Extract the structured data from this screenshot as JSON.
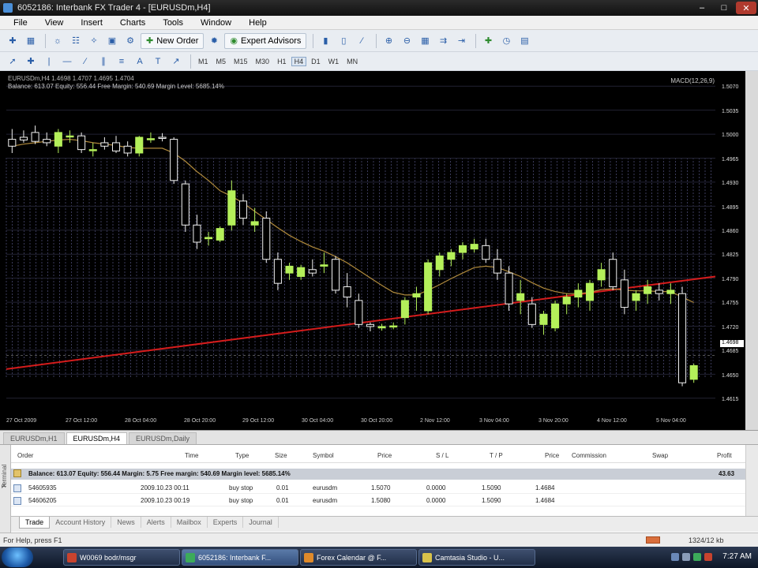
{
  "window": {
    "title": "6052186: Interbank FX Trader 4 - [EURUSDm,H4]"
  },
  "menu": [
    "File",
    "View",
    "Insert",
    "Charts",
    "Tools",
    "Window",
    "Help"
  ],
  "toolbar": {
    "new_order_label": "New Order",
    "expert_advisors_label": "Expert Advisors",
    "timeframes": [
      "M1",
      "M5",
      "M15",
      "M30",
      "H1",
      "H4",
      "D1",
      "W1",
      "MN"
    ],
    "active_timeframe": "H4"
  },
  "chart": {
    "symbol_line": "EURUSDm,H4 1.4698 1.4707 1.4695 1.4704",
    "info_line": "Balance: 613.07  Equity: 556.44  Free Margin: 540.69  Margin Level: 5685.14%",
    "indicator_label": "MACD(12,26,9)",
    "price_labels": [
      "1.5070",
      "1.5035",
      "1.5000",
      "1.4965",
      "1.4930",
      "1.4895",
      "1.4860",
      "1.4825",
      "1.4790",
      "1.4755",
      "1.4720",
      "1.4685",
      "1.4650",
      "1.4615"
    ],
    "current_price_tag": "1.4698",
    "time_labels": [
      "27 Oct 2009",
      "27 Oct 12:00",
      "28 Oct 04:00",
      "28 Oct 20:00",
      "29 Oct 12:00",
      "30 Oct 04:00",
      "30 Oct 20:00",
      "2 Nov 12:00",
      "3 Nov 04:00",
      "3 Nov 20:00",
      "4 Nov 12:00",
      "5 Nov 04:00"
    ]
  },
  "chart_tabs": [
    "EURUSDm,H1",
    "EURUSDm,H4",
    "EURUSDm,Daily"
  ],
  "active_chart_tab": "EURUSDm,H4",
  "terminal": {
    "side_label": "Terminal",
    "columns": [
      "Order",
      "Time",
      "Type",
      "Size",
      "Symbol",
      "Price",
      "S / L",
      "T / P",
      "Price",
      "Commission",
      "Swap",
      "Profit"
    ],
    "balance_row": "Balance: 613.07  Equity: 556.44  Margin: 5.75  Free margin: 540.69  Margin level: 5685.14%",
    "balance_profit": "43.63",
    "orders": [
      {
        "order": "54605935",
        "time": "2009.10.23 00:11",
        "type": "buy stop",
        "size": "0.01",
        "symbol": "eurusdm",
        "price": "1.5070",
        "sl": "0.0000",
        "tp": "1.5090",
        "current": "1.4684"
      },
      {
        "order": "54606205",
        "time": "2009.10.23 00:19",
        "type": "buy stop",
        "size": "0.01",
        "symbol": "eurusdm",
        "price": "1.5080",
        "sl": "0.0000",
        "tp": "1.5090",
        "current": "1.4684"
      }
    ],
    "tabs": [
      "Trade",
      "Account History",
      "News",
      "Alerts",
      "Mailbox",
      "Experts",
      "Journal"
    ],
    "active_tab": "Trade"
  },
  "status": {
    "help": "For Help, press F1",
    "traffic": "1324/12 kb"
  },
  "taskbar": {
    "items": [
      "W0069 bodr/msgr",
      "6052186: Interbank F...",
      "Forex Calendar @ F...",
      "Camtasia Studio - U..."
    ],
    "active_item": "6052186: Interbank F...",
    "clock": "7:27 AM"
  },
  "chart_data": {
    "type": "candlestick",
    "symbol": "EURUSDm",
    "timeframe": "H4",
    "ylim": [
      1.46,
      1.509
    ],
    "grid": true,
    "candles": [
      {
        "o": 1.4995,
        "h": 1.501,
        "l": 1.4975,
        "c": 1.4985
      },
      {
        "o": 1.4998,
        "h": 1.5008,
        "l": 1.499,
        "c": 1.4994
      },
      {
        "o": 1.5005,
        "h": 1.5015,
        "l": 1.4988,
        "c": 1.4992
      },
      {
        "o": 1.4995,
        "h": 1.5005,
        "l": 1.4985,
        "c": 1.499
      },
      {
        "o": 1.4985,
        "h": 1.501,
        "l": 1.4975,
        "c": 1.5005
      },
      {
        "o": 1.5,
        "h": 1.5008,
        "l": 1.499,
        "c": 1.5
      },
      {
        "o": 1.5,
        "h": 1.5005,
        "l": 1.4975,
        "c": 1.498
      },
      {
        "o": 1.498,
        "h": 1.499,
        "l": 1.497,
        "c": 1.498
      },
      {
        "o": 1.499,
        "h": 1.4998,
        "l": 1.498,
        "c": 1.4985
      },
      {
        "o": 1.499,
        "h": 1.5,
        "l": 1.4975,
        "c": 1.4978
      },
      {
        "o": 1.4985,
        "h": 1.4992,
        "l": 1.497,
        "c": 1.4975
      },
      {
        "o": 1.4975,
        "h": 1.5,
        "l": 1.497,
        "c": 1.4998
      },
      {
        "o": 1.4995,
        "h": 1.5005,
        "l": 1.499,
        "c": 1.4996
      },
      {
        "o": 1.4998,
        "h": 1.5004,
        "l": 1.4992,
        "c": 1.4997
      },
      {
        "o": 1.4995,
        "h": 1.4998,
        "l": 1.493,
        "c": 1.4935
      },
      {
        "o": 1.493,
        "h": 1.4935,
        "l": 1.486,
        "c": 1.487
      },
      {
        "o": 1.487,
        "h": 1.4885,
        "l": 1.4835,
        "c": 1.4845
      },
      {
        "o": 1.485,
        "h": 1.486,
        "l": 1.484,
        "c": 1.4852
      },
      {
        "o": 1.4848,
        "h": 1.4868,
        "l": 1.4845,
        "c": 1.4865
      },
      {
        "o": 1.487,
        "h": 1.4935,
        "l": 1.4862,
        "c": 1.492
      },
      {
        "o": 1.4905,
        "h": 1.4915,
        "l": 1.487,
        "c": 1.488
      },
      {
        "o": 1.487,
        "h": 1.4895,
        "l": 1.486,
        "c": 1.4875
      },
      {
        "o": 1.488,
        "h": 1.489,
        "l": 1.4815,
        "c": 1.482
      },
      {
        "o": 1.482,
        "h": 1.483,
        "l": 1.4775,
        "c": 1.4785
      },
      {
        "o": 1.48,
        "h": 1.4815,
        "l": 1.479,
        "c": 1.481
      },
      {
        "o": 1.4795,
        "h": 1.4812,
        "l": 1.479,
        "c": 1.4808
      },
      {
        "o": 1.4805,
        "h": 1.482,
        "l": 1.4795,
        "c": 1.48
      },
      {
        "o": 1.481,
        "h": 1.483,
        "l": 1.48,
        "c": 1.4812
      },
      {
        "o": 1.482,
        "h": 1.4825,
        "l": 1.477,
        "c": 1.4775
      },
      {
        "o": 1.478,
        "h": 1.48,
        "l": 1.475,
        "c": 1.4765
      },
      {
        "o": 1.476,
        "h": 1.477,
        "l": 1.472,
        "c": 1.4725
      },
      {
        "o": 1.4725,
        "h": 1.4728,
        "l": 1.4715,
        "c": 1.4722
      },
      {
        "o": 1.472,
        "h": 1.4726,
        "l": 1.4716,
        "c": 1.4722
      },
      {
        "o": 1.4722,
        "h": 1.4728,
        "l": 1.4718,
        "c": 1.4723
      },
      {
        "o": 1.4735,
        "h": 1.4765,
        "l": 1.4725,
        "c": 1.476
      },
      {
        "o": 1.4765,
        "h": 1.478,
        "l": 1.4745,
        "c": 1.477
      },
      {
        "o": 1.4745,
        "h": 1.482,
        "l": 1.474,
        "c": 1.4815
      },
      {
        "o": 1.4805,
        "h": 1.483,
        "l": 1.4795,
        "c": 1.4825
      },
      {
        "o": 1.482,
        "h": 1.4835,
        "l": 1.481,
        "c": 1.483
      },
      {
        "o": 1.483,
        "h": 1.4845,
        "l": 1.482,
        "c": 1.484
      },
      {
        "o": 1.4835,
        "h": 1.485,
        "l": 1.483,
        "c": 1.4842
      },
      {
        "o": 1.484,
        "h": 1.485,
        "l": 1.4815,
        "c": 1.482
      },
      {
        "o": 1.482,
        "h": 1.4835,
        "l": 1.479,
        "c": 1.48
      },
      {
        "o": 1.48,
        "h": 1.481,
        "l": 1.4745,
        "c": 1.4755
      },
      {
        "o": 1.476,
        "h": 1.479,
        "l": 1.474,
        "c": 1.477
      },
      {
        "o": 1.4755,
        "h": 1.4765,
        "l": 1.472,
        "c": 1.4725
      },
      {
        "o": 1.4725,
        "h": 1.4745,
        "l": 1.471,
        "c": 1.474
      },
      {
        "o": 1.472,
        "h": 1.476,
        "l": 1.4715,
        "c": 1.4755
      },
      {
        "o": 1.4755,
        "h": 1.477,
        "l": 1.474,
        "c": 1.4765
      },
      {
        "o": 1.4765,
        "h": 1.4785,
        "l": 1.475,
        "c": 1.4775
      },
      {
        "o": 1.476,
        "h": 1.479,
        "l": 1.4745,
        "c": 1.4785
      },
      {
        "o": 1.479,
        "h": 1.4815,
        "l": 1.478,
        "c": 1.4805
      },
      {
        "o": 1.482,
        "h": 1.483,
        "l": 1.4775,
        "c": 1.478
      },
      {
        "o": 1.479,
        "h": 1.4805,
        "l": 1.474,
        "c": 1.475
      },
      {
        "o": 1.476,
        "h": 1.4775,
        "l": 1.4745,
        "c": 1.477
      },
      {
        "o": 1.477,
        "h": 1.479,
        "l": 1.4755,
        "c": 1.478
      },
      {
        "o": 1.4775,
        "h": 1.4785,
        "l": 1.476,
        "c": 1.477
      },
      {
        "o": 1.477,
        "h": 1.4785,
        "l": 1.4755,
        "c": 1.4775
      },
      {
        "o": 1.477,
        "h": 1.478,
        "l": 1.4635,
        "c": 1.464
      },
      {
        "o": 1.4645,
        "h": 1.4668,
        "l": 1.464,
        "c": 1.4665
      }
    ],
    "moving_average": [
      1.4985,
      1.4988,
      1.499,
      1.4992,
      1.4994,
      1.4995,
      1.4993,
      1.499,
      1.4988,
      1.4986,
      1.4983,
      1.4982,
      1.4982,
      1.4982,
      1.4975,
      1.4963,
      1.4948,
      1.4935,
      1.492,
      1.4912,
      1.4902,
      1.489,
      1.4878,
      1.4866,
      1.4855,
      1.4846,
      1.4838,
      1.4832,
      1.4824,
      1.4815,
      1.4804,
      1.4793,
      1.4782,
      1.4772,
      1.4768,
      1.4768,
      1.4775,
      1.4783,
      1.4792,
      1.48,
      1.4808,
      1.481,
      1.4808,
      1.4802,
      1.4795,
      1.4786,
      1.4778,
      1.4773,
      1.477,
      1.477,
      1.4772,
      1.4776,
      1.4777,
      1.4775,
      1.4774,
      1.4774,
      1.4773,
      1.4773,
      1.4765,
      1.4757
    ],
    "trend_line": {
      "start": 1.466,
      "end": 1.4795
    },
    "colors": {
      "bull": "#b4f05a",
      "bear": "#f2f2f2",
      "ma": "#b08a3c",
      "trend": "#d41c1c",
      "grid": "#3a3a5a"
    }
  }
}
